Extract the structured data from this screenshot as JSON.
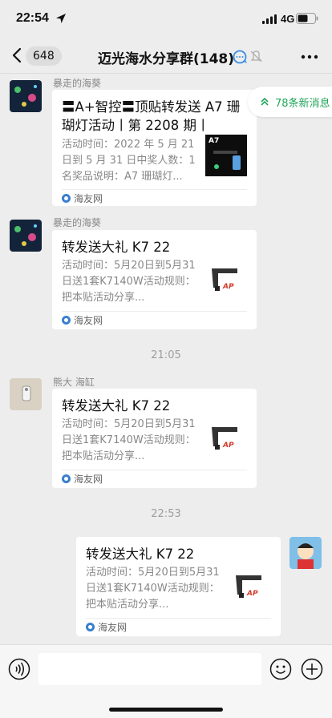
{
  "status_bar": {
    "time": "22:54",
    "network": "4G"
  },
  "nav": {
    "unread_count": "648",
    "title": "迈光海水分享群(148)"
  },
  "new_messages_label": "78条新消息",
  "timestamps": [
    "21:05",
    "22:53"
  ],
  "messages": [
    {
      "sender": "暴走的海葵",
      "title": "〓A+智控〓顶贴转发送 A7 珊瑚灯活动丨第 2208 期丨",
      "desc": "活动时间：2022 年 5 月 21 日到 5 月 31 日中奖人数：1 名奖品说明：A7 珊瑚灯...",
      "thumb_text": "A7",
      "source": "海友网"
    },
    {
      "sender": "暴走的海葵",
      "title": "转发送大礼 K7 22",
      "desc": "活动时间：5月20日到5月31日送1套K7140W活动规则：把本贴活动分享...",
      "thumb_text": "AP",
      "source": "海友网"
    },
    {
      "sender": "熊大 海缸",
      "title": "转发送大礼 K7 22",
      "desc": "活动时间：5月20日到5月31日送1套K7140W活动规则：把本贴活动分享...",
      "thumb_text": "AP",
      "source": "海友网"
    },
    {
      "sender": "",
      "title": "转发送大礼 K7 22",
      "desc": "活动时间：5月20日到5月31日送1套K7140W活动规则：把本贴活动分享...",
      "thumb_text": "AP",
      "source": "海友网"
    }
  ],
  "input": {
    "value": "",
    "placeholder": ""
  },
  "colors": {
    "background": "#ededed",
    "accent_green": "#21a55a",
    "card": "#ffffff"
  },
  "icons": [
    "location-arrow-icon",
    "signal-bars-icon",
    "battery-icon",
    "back-chevron-icon",
    "speech-bubble-icon",
    "mute-bell-icon",
    "more-dots-icon",
    "double-chevron-up-icon",
    "source-logo-icon",
    "voice-icon",
    "emoji-icon",
    "plus-icon"
  ]
}
